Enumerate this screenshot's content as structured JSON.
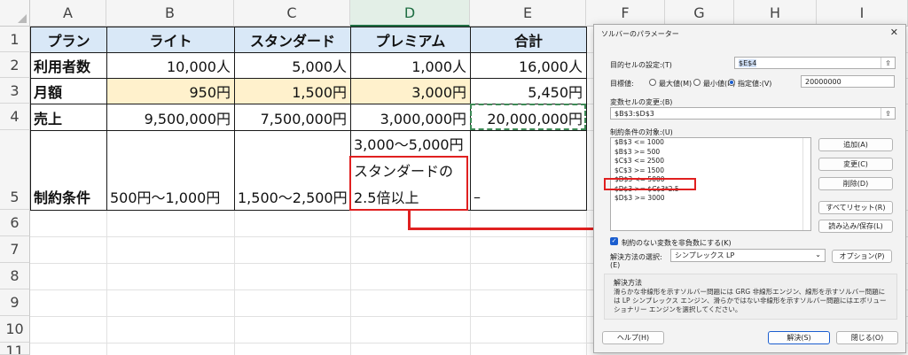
{
  "sheet": {
    "columns": [
      "A",
      "B",
      "C",
      "D",
      "E",
      "F",
      "G",
      "H",
      "I"
    ],
    "rows": [
      "1",
      "2",
      "3",
      "4",
      "5",
      "6",
      "7",
      "8",
      "9",
      "10",
      "11"
    ],
    "header": [
      "プラン",
      "ライト",
      "スタンダード",
      "プレミアム",
      "合計"
    ],
    "r2": [
      "利用者数",
      "10,000人",
      "5,000人",
      "1,000人",
      "16,000人"
    ],
    "r3": [
      "月額",
      "950円",
      "1,500円",
      "3,000円",
      "5,450円"
    ],
    "r4": [
      "売上",
      "9,500,000円",
      "7,500,000円",
      "3,000,000円",
      "20,000,000円"
    ],
    "r5": {
      "label": "制約条件",
      "b": "500円〜1,000円",
      "c": "1,500〜2,500円",
      "d_line1": "3,000〜5,000円",
      "d_line2": "スタンダードの",
      "d_line3": "2.5倍以上",
      "e": "–"
    }
  },
  "dialog": {
    "title": "ソルバーのパラメーター",
    "close": "✕",
    "objective_label": "目的セルの設定:(T)",
    "objective_value": "$E$4",
    "target_label": "目標値:",
    "radio_max": "最大値(M)",
    "radio_min": "最小値(N)",
    "radio_value": "指定値:(V)",
    "target_value": "20000000",
    "variable_label": "変数セルの変更:(B)",
    "variable_value": "$B$3:$D$3",
    "constraints_label": "制約条件の対象:(U)",
    "constraints": [
      "$B$3 <= 1000",
      "$B$3 >= 500",
      "$C$3 <= 2500",
      "$C$3 >= 1500",
      "$D$3 <= 5000",
      "$D$3 >= $C$3*2.5",
      "$D$3 >= 3000"
    ],
    "btn_add": "追加(A)",
    "btn_change": "変更(C)",
    "btn_delete": "削除(D)",
    "btn_reset": "すべてリセット(R)",
    "btn_loadsave": "読み込み/保存(L)",
    "nonneg_label": "制約のない変数を非負数にする(K)",
    "method_label": "解決方法の選択:",
    "method_label2": "(E)",
    "method_value": "シンプレックス LP",
    "btn_options": "オプション(P)",
    "desc_title": "解決方法",
    "desc_text": "滑らかな非線形を示すソルバー問題には GRG 非線形エンジン、線形を示すソルバー問題には LP シンプレックス エンジン、滑らかではない非線形を示すソルバー問題にはエボリューショナリー エンジンを選択してください。",
    "btn_help": "ヘルプ(H)",
    "btn_solve": "解決(S)",
    "btn_close": "閉じる(O)"
  },
  "colors": {
    "header_fill": "#d9e8f7",
    "yellow_fill": "#fff1cc",
    "highlight_red": "#e02020",
    "selection_green": "#1f6e43"
  }
}
